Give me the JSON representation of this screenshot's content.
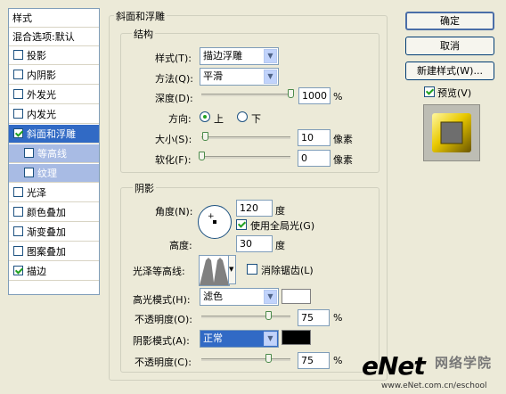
{
  "styles_list": {
    "header": "样式",
    "blend": "混合选项:默认",
    "items": [
      {
        "label": "投影",
        "checked": false
      },
      {
        "label": "内阴影",
        "checked": false
      },
      {
        "label": "外发光",
        "checked": false
      },
      {
        "label": "内发光",
        "checked": false
      },
      {
        "label": "斜面和浮雕",
        "checked": true,
        "selected": true
      },
      {
        "label": "等高线",
        "checked": false,
        "sub": true
      },
      {
        "label": "纹理",
        "checked": false,
        "sub": true
      },
      {
        "label": "光泽",
        "checked": false
      },
      {
        "label": "颜色叠加",
        "checked": false
      },
      {
        "label": "渐变叠加",
        "checked": false
      },
      {
        "label": "图案叠加",
        "checked": false
      },
      {
        "label": "描边",
        "checked": true
      }
    ]
  },
  "bevel": {
    "title": "斜面和浮雕",
    "structure": {
      "title": "结构",
      "style_label": "样式(T):",
      "style_value": "描边浮雕",
      "technique_label": "方法(Q):",
      "technique_value": "平滑",
      "depth_label": "深度(D):",
      "depth_value": "1000",
      "depth_unit": "%",
      "depth_level": 1.0,
      "direction_label": "方向:",
      "direction_up": "上",
      "direction_down": "下",
      "size_label": "大小(S):",
      "size_value": "10",
      "size_unit": "像素",
      "size_level": 0.04,
      "soften_label": "软化(F):",
      "soften_value": "0",
      "soften_unit": "像素",
      "soften_level": 0.0
    },
    "shading": {
      "title": "阴影",
      "angle_label": "角度(N):",
      "angle_value": "120",
      "angle_unit": "度",
      "global_light_label": "使用全局光(G)",
      "altitude_label": "高度:",
      "altitude_value": "30",
      "altitude_unit": "度",
      "gloss_contour_label": "光泽等高线:",
      "anti_alias_label": "消除锯齿(L)",
      "highlight_mode_label": "高光模式(H):",
      "highlight_mode_value": "滤色",
      "highlight_color": "#ffffff",
      "highlight_opacity_label": "不透明度(O):",
      "highlight_opacity_value": "75",
      "highlight_opacity_unit": "%",
      "shadow_mode_label": "阴影模式(A):",
      "shadow_mode_value": "正常",
      "shadow_color": "#000000",
      "shadow_opacity_label": "不透明度(C):",
      "shadow_opacity_value": "75",
      "shadow_opacity_unit": "%"
    }
  },
  "buttons": {
    "ok": "确定",
    "cancel": "取消",
    "new_style": "新建样式(W)...",
    "preview_label": "预览(V)"
  },
  "watermark": {
    "brand": "eNet",
    "cn": "网络学院",
    "url": "www.eNet.com.cn/eschool"
  }
}
